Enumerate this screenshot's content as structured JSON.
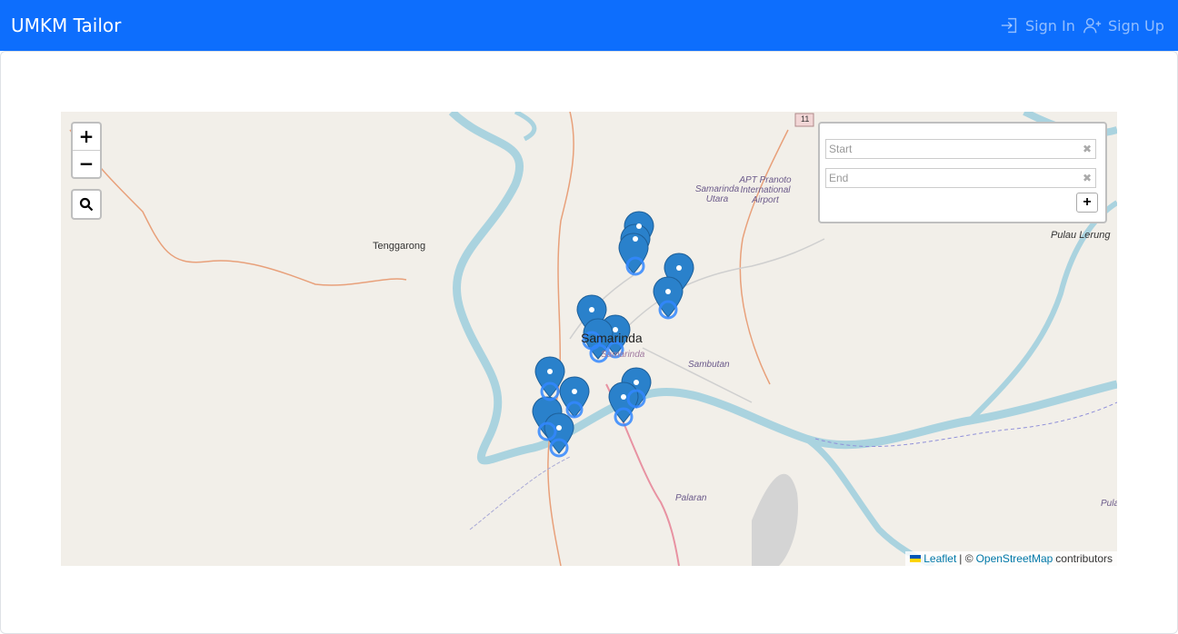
{
  "navbar": {
    "brand": "UMKM Tailor",
    "signin_label": "Sign In",
    "signup_label": "Sign Up",
    "signin_icon": "box-arrow-in-right-icon",
    "signup_icon": "person-plus-icon",
    "bg_color": "#0d6efd"
  },
  "map": {
    "zoom_in": "+",
    "zoom_out": "−",
    "search_icon": "search-icon",
    "routing": {
      "start_placeholder": "Start",
      "end_placeholder": "End",
      "clear_glyph": "✖",
      "add_label": "+"
    },
    "attribution": {
      "leaflet": "Leaflet",
      "sep": "| ©",
      "osm": "OpenStreetMap",
      "suffix": "contributors"
    },
    "labels": {
      "tenggarong": "Tenggarong",
      "samarinda": "Samarinda",
      "samarinda_small": "Samarinda",
      "samarinda_utara": "Samarinda Utara",
      "airport": "APT Pranoto International Airport",
      "pulau_lerung": "Pulau Lerung",
      "sambutan": "Sambutan",
      "palaran": "Palaran",
      "pula": "Pula",
      "road_11": "11"
    },
    "marker_color": "#2a81cb"
  }
}
